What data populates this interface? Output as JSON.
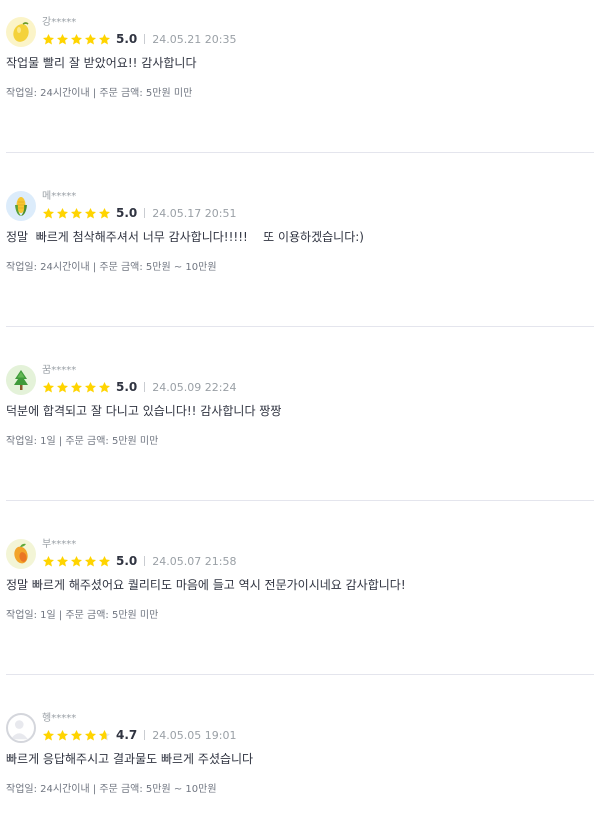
{
  "reviews": [
    {
      "user": "강*****",
      "avatar_icon": "lemon-icon",
      "rating": 5.0,
      "score": "5.0",
      "date": "24.05.21 20:35",
      "content": "작업물 빨리 잘 받았어요!! 감사합니다",
      "detail": "작업일: 24시간이내 | 주문 금액: 5만원 미만"
    },
    {
      "user": "메*****",
      "avatar_icon": "corn-icon",
      "rating": 5.0,
      "score": "5.0",
      "date": "24.05.17 20:51",
      "content": "정말  빠르게 첨삭해주셔서 너무 감사합니다!!!!!    또 이용하겠습니다:)",
      "detail": "작업일: 24시간이내 | 주문 금액: 5만원 ~ 10만원"
    },
    {
      "user": "꿈*****",
      "avatar_icon": "tree-icon",
      "rating": 5.0,
      "score": "5.0",
      "date": "24.05.09 22:24",
      "content": "덕분에 합격되고 잘 다니고 있습니다!! 감사합니다 짱짱",
      "detail": "작업일: 1일 | 주문 금액: 5만원 미만"
    },
    {
      "user": "부*****",
      "avatar_icon": "mango-icon",
      "rating": 5.0,
      "score": "5.0",
      "date": "24.05.07 21:58",
      "content": "정말 빠르게 해주셨어요 퀄리티도 마음에 들고 역시 전문가이시네요 감사합니다!",
      "detail": "작업일: 1일 | 주문 금액: 5만원 미만"
    },
    {
      "user": "헹*****",
      "avatar_icon": "default-avatar-icon",
      "rating": 4.7,
      "score": "4.7",
      "date": "24.05.05 19:01",
      "content": "빠르게 응답해주시고 결과물도 빠르게 주셨습니다",
      "detail": "작업일: 24시간이내 | 주문 금액: 5만원 ~ 10만원"
    }
  ],
  "colors": {
    "star": "#FFD400",
    "star_empty": "#E4E5ED",
    "divider": "#E4E5ED"
  }
}
